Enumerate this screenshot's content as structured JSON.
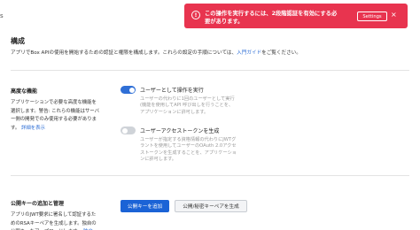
{
  "stub_text": "s",
  "section": {
    "title": "構成",
    "desc_text": "アプリでBox APIの使用を開始するための認証と権限を構成します。これらの設定の手順については、",
    "desc_link": "入門ガイド",
    "desc_end": "をご覧ください。"
  },
  "advanced": {
    "title": "高度な機能",
    "desc": "アプリケーションで必要な高度な機能を選択します。警告: これらの機能はサーバー側の開発でのみ使用する必要があります。",
    "link": "詳細を表示",
    "toggles": [
      {
        "title": "ユーザーとして操作を実行",
        "desc": "ユーザーの代わりに1回のユーザーとして実行(機能を使用してAPI 呼び出しを行うことを、アプリケーションに許可します。",
        "state": "on"
      },
      {
        "title": "ユーザーアクセストークンを生成",
        "desc": "ユーザーが指定する資格情報の代わりにJWTグラントを使用してユーザーのOAuth 2.0アクセストークンを生成することを、アプリケーションに許可します。",
        "state": "off"
      }
    ]
  },
  "pubkey": {
    "title": "公開キーの追加と管理",
    "desc": "アプリのJWT要求に署名して認証するためのRSAキーペアを生成します。独自の公開キーをアップロードします。",
    "link": "独自",
    "add_button": "公開キーを追加",
    "generate_button": "公開/秘密キーペアを生成"
  },
  "toast": {
    "icon": "alert-icon",
    "message": "この操作を実行するには、2段階認証を有効にする必要があります。",
    "settings_button": "Settings",
    "close": "×"
  },
  "colors": {
    "accent": "#2f6fd6",
    "toast_bg": "#e8344f",
    "primary_button": "#1b63d6"
  }
}
